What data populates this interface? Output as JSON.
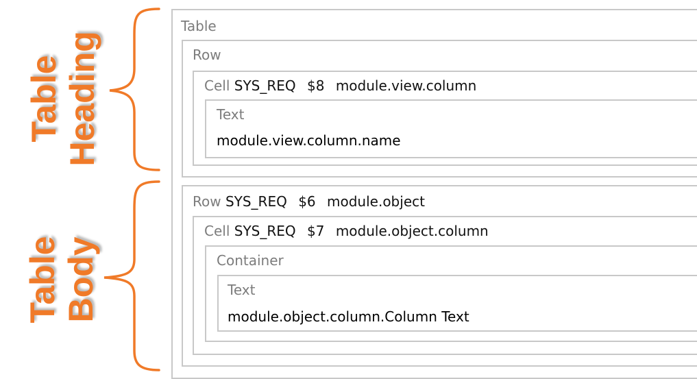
{
  "side_labels": {
    "heading": {
      "line1": "Table",
      "line2": "Heading"
    },
    "body": {
      "line1": "Table",
      "line2": "Body"
    }
  },
  "tree": {
    "table": {
      "kind": "Table"
    },
    "heading_row": {
      "kind": "Row"
    },
    "heading_cell": {
      "kind": "Cell",
      "req": "SYS_REQ",
      "ref": "$8",
      "path": "module.view.column"
    },
    "heading_text": {
      "kind": "Text",
      "value": "module.view.column.name"
    },
    "body_row": {
      "kind": "Row",
      "req": "SYS_REQ",
      "ref": "$6",
      "path": "module.object"
    },
    "body_cell": {
      "kind": "Cell",
      "req": "SYS_REQ",
      "ref": "$7",
      "path": "module.object.column"
    },
    "container": {
      "kind": "Container"
    },
    "body_text": {
      "kind": "Text",
      "value": "module.object.column.Column Text"
    }
  },
  "colors": {
    "accent": "#f07a28",
    "border": "#c8c8c8",
    "kind_text": "#7c7c7c"
  }
}
